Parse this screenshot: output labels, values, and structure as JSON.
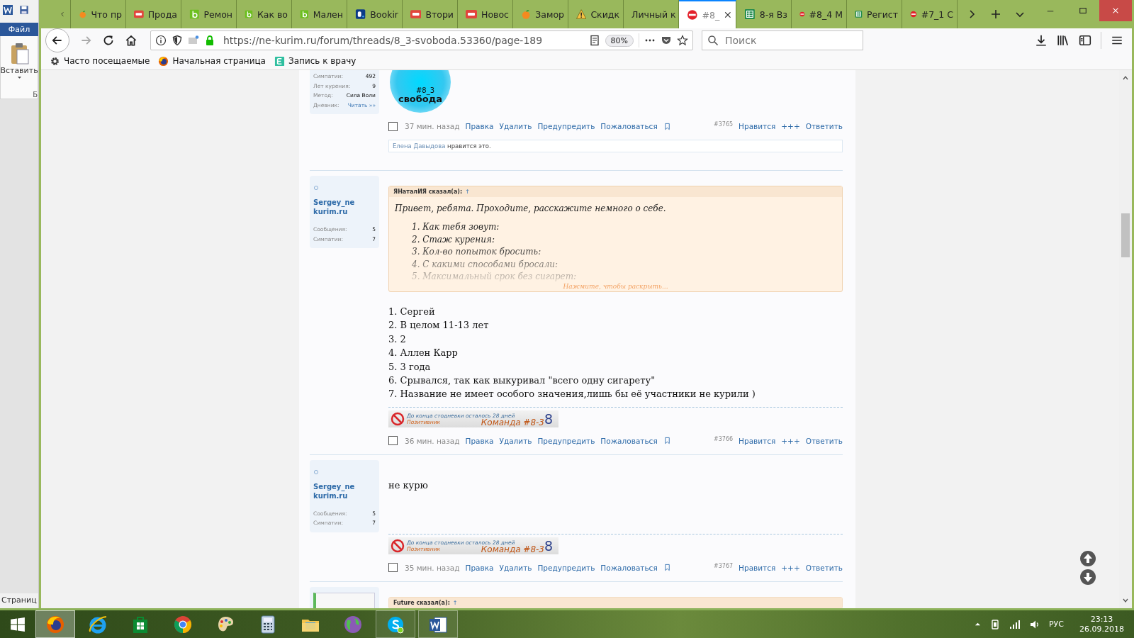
{
  "word_strip": {
    "file_tab": "Файл",
    "paste_label": "Вставить",
    "group_label": "Б",
    "status_text": "Страниц"
  },
  "browser": {
    "tabs": [
      {
        "label": "Что пр",
        "kind": "fruit",
        "selected": false
      },
      {
        "label": "Прода",
        "kind": "ru",
        "selected": false
      },
      {
        "label": "Ремон",
        "kind": "b",
        "selected": false
      },
      {
        "label": "Как во",
        "kind": "b",
        "selected": false
      },
      {
        "label": "Мален",
        "kind": "b",
        "selected": false
      },
      {
        "label": "Bookir",
        "kind": "booking",
        "selected": false
      },
      {
        "label": "Втори",
        "kind": "ru",
        "selected": false
      },
      {
        "label": "Новос",
        "kind": "ru",
        "selected": false
      },
      {
        "label": "Замор",
        "kind": "fruit",
        "selected": false
      },
      {
        "label": "Скидк",
        "kind": "warning",
        "selected": false
      },
      {
        "label": "Личный к",
        "kind": "plain",
        "selected": false
      },
      {
        "label": "#8_",
        "kind": "noentry",
        "selected": true
      },
      {
        "label": "8-я Вз",
        "kind": "sheet",
        "selected": false
      },
      {
        "label": "#8_4 М",
        "kind": "noentry",
        "selected": false
      },
      {
        "label": "Регист",
        "kind": "sheet",
        "selected": false
      },
      {
        "label": "#7_1 С",
        "kind": "noentry",
        "selected": false
      }
    ],
    "url": "https://ne-kurim.ru/forum/threads/8_3-svoboda.53360/page-189",
    "zoom": "80%",
    "search": {
      "placeholder": "Поиск"
    },
    "bookmarks": [
      {
        "label": "Часто посещаемые",
        "kind": "gear"
      },
      {
        "label": "Начальная страница",
        "kind": "firefox"
      },
      {
        "label": "Запись к врачу",
        "kind": "etile"
      }
    ]
  },
  "posts": [
    {
      "user": {
        "kind": "stats",
        "stats": [
          {
            "label": "Симпатии:",
            "value": "492",
            "kind": "value"
          },
          {
            "label": "Лет курения:",
            "value": "9",
            "kind": "value"
          },
          {
            "label": "Метод:",
            "value": "Сила Воли",
            "kind": "value"
          },
          {
            "label": "Дневник:",
            "value": "Читать »»",
            "kind": "link"
          }
        ]
      },
      "logo": {
        "tag": "#8_3",
        "word": "свобода"
      },
      "meta": {
        "checked": false,
        "time": "37 мин. назад",
        "actions": [
          "Правка",
          "Удалить",
          "Предупредить",
          "Пожаловаться"
        ],
        "number": "#3765",
        "reactions": [
          "Нравится",
          "+++",
          "Ответить"
        ]
      },
      "likes": {
        "user": "Елена Давыдова",
        "text": "нравится это."
      }
    },
    {
      "user": {
        "kind": "stats",
        "name": "Sergey_ne kurim.ru",
        "stats": [
          {
            "label": "Сообщения:",
            "value": "5",
            "kind": "value"
          },
          {
            "label": "Симпатии:",
            "value": "7",
            "kind": "value"
          }
        ]
      },
      "quote": {
        "author": "ЯНаталИЯ сказал(а):",
        "jump": "↑",
        "lead": "Привет, ребята. Проходите, расскажите немного о себе.",
        "items": [
          "1. Как тебя зовут:",
          "2. Стаж курения:",
          "3. Кол-во попыток бросить:",
          "4. С какими способами бросали:",
          "5. Максимальный срок без сигарет:"
        ],
        "expanded": false,
        "expand_hint": "Нажмите, чтобы раскрыть..."
      },
      "lines": [
        "1. Сергей",
        "2. В целом 11-13 лет",
        "3. 2",
        "4. Аллен Карр",
        "5. 3 года",
        "6. Срывался, так как выкуривал \"всего одну сигарету\"",
        "7. Название не имеет особого значения,лишь бы её участники не курили )"
      ],
      "signature": {
        "countdown": "До конца стодневки осталось 28 дней",
        "role": "Позитивник",
        "team": "Команда #8-3",
        "digit": "8"
      },
      "meta": {
        "checked": false,
        "time": "36 мин. назад",
        "actions": [
          "Правка",
          "Удалить",
          "Предупредить",
          "Пожаловаться"
        ],
        "number": "#3766",
        "reactions": [
          "Нравится",
          "+++",
          "Ответить"
        ]
      }
    },
    {
      "user": {
        "kind": "stats",
        "name": "Sergey_ne kurim.ru",
        "stats": [
          {
            "label": "Сообщения:",
            "value": "5",
            "kind": "value"
          },
          {
            "label": "Симпатии:",
            "value": "7",
            "kind": "value"
          }
        ]
      },
      "lines": [
        "не курю"
      ],
      "signature": {
        "countdown": "До конца стодневки осталось 28 дней",
        "role": "Позитивник",
        "team": "Команда #8-3",
        "digit": "8"
      },
      "meta": {
        "checked": false,
        "time": "35 мин. назад",
        "actions": [
          "Правка",
          "Удалить",
          "Предупредить",
          "Пожаловаться"
        ],
        "number": "#3767",
        "reactions": [
          "Нравится",
          "+++",
          "Ответить"
        ]
      }
    },
    {
      "user": {
        "kind": "avatar"
      },
      "quote": {
        "author": "Future сказал(а):",
        "jump": "↑"
      }
    }
  ],
  "taskbar": {
    "apps": [
      {
        "kind": "firefox",
        "selected": true,
        "running": true
      },
      {
        "kind": "ie",
        "selected": false,
        "running": false
      },
      {
        "kind": "store",
        "selected": false,
        "running": false
      },
      {
        "kind": "chrome",
        "selected": false,
        "running": false
      },
      {
        "kind": "paint",
        "selected": false,
        "running": false
      },
      {
        "kind": "calculator",
        "selected": false,
        "running": false
      },
      {
        "kind": "explorer",
        "selected": false,
        "running": false
      },
      {
        "kind": "globe",
        "selected": false,
        "running": false
      },
      {
        "kind": "skype",
        "selected": false,
        "running": true
      },
      {
        "kind": "word",
        "selected": false,
        "running": true
      }
    ],
    "language": "РУС",
    "time": "23:13",
    "date": "26.09.2018"
  }
}
